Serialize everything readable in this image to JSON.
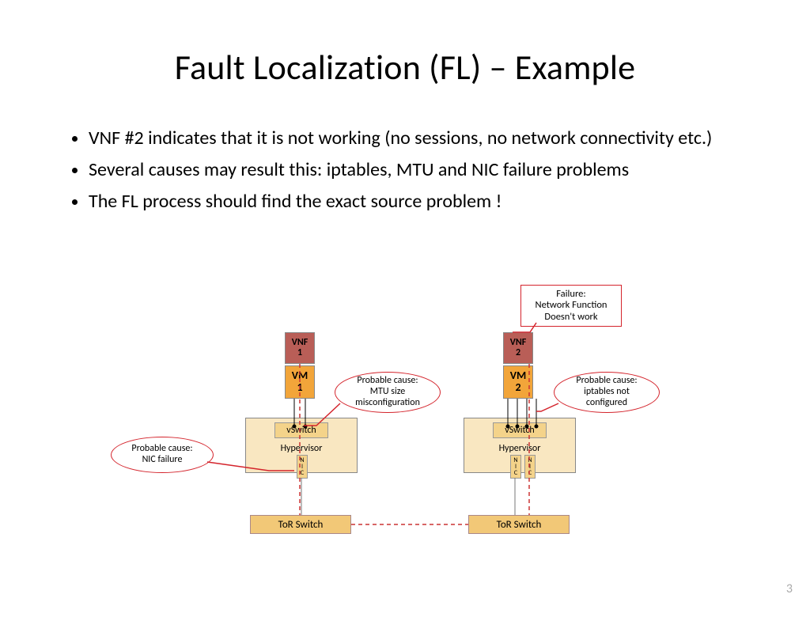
{
  "title": "Fault Localization (FL) – Example",
  "bullets": [
    "VNF #2 indicates that it is not working (no sessions, no network connectivity etc.)",
    "Several causes may result this: iptables, MTU and NIC failure problems",
    "The FL process should find the exact source problem !"
  ],
  "page_number": "3",
  "diagram": {
    "left": {
      "vnf": "VNF\n1",
      "vm": "VM\n1",
      "vswitch": "vSwitch",
      "hypervisor": "Hypervisor",
      "nic": "N\nI\nC",
      "tor": "ToR Switch"
    },
    "right": {
      "vnf": "VNF\n2",
      "vm": "VM\n2",
      "vswitch": "vSwitch",
      "hypervisor": "Hypervisor",
      "nic1": "N\nI\nC",
      "nic2": "N\nI\nC",
      "tor": "ToR Switch"
    },
    "callouts": {
      "failure": "Failure:\nNetwork Function\nDoesn't work",
      "mtu": "Probable cause:\nMTU size\nmisconfiguration",
      "iptables": "Probable cause:\niptables not\nconfigured",
      "nicfail": "Probable cause:\nNIC failure"
    }
  }
}
